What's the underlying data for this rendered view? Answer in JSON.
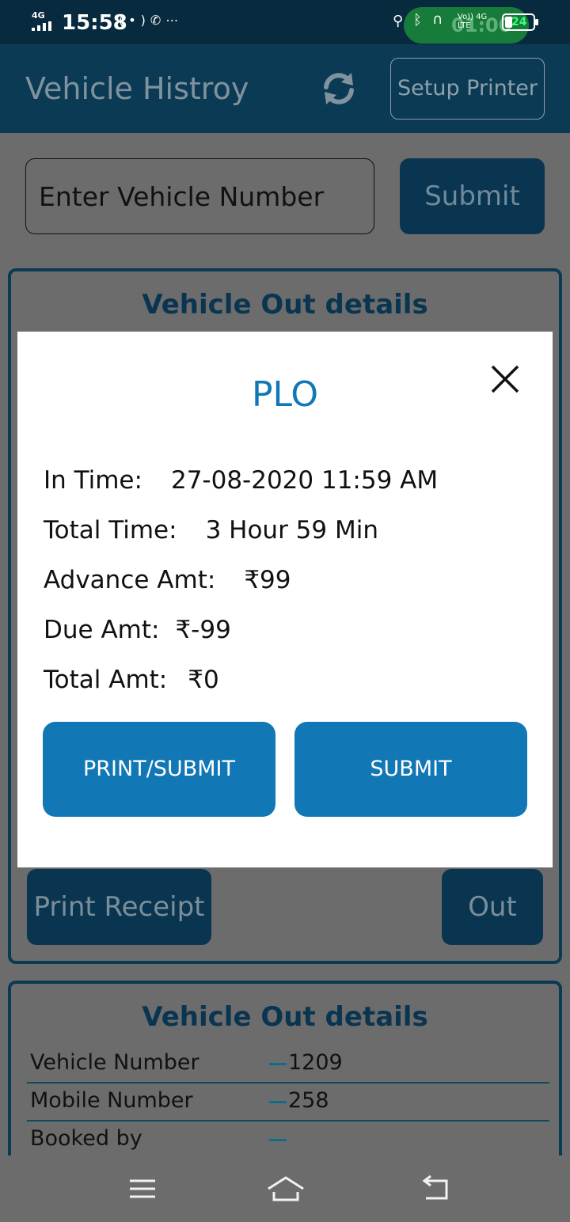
{
  "status_bar": {
    "network": "4G",
    "time": "15:58",
    "call_timer": "01:00",
    "volte_top": "Vo)) 4G",
    "volte_bottom": "LTE",
    "battery": "24"
  },
  "header": {
    "title": "Vehicle Histroy",
    "refresh_icon": "refresh-icon",
    "setup_printer_label": "Setup Printer"
  },
  "search": {
    "placeholder": "Enter Vehicle Number",
    "submit_label": "Submit"
  },
  "out_card": {
    "title": "Vehicle Out details",
    "print_receipt_label": "Print Receipt",
    "out_label": "Out"
  },
  "details_card": {
    "title": "Vehicle Out details",
    "rows": [
      {
        "label": "Vehicle Number",
        "value": "1209"
      },
      {
        "label": "Mobile Number",
        "value": "258"
      },
      {
        "label": "Booked by",
        "value": ""
      }
    ]
  },
  "modal": {
    "title": "PLO",
    "rows": [
      {
        "label": "In Time:",
        "value": "27-08-2020 11:59 AM"
      },
      {
        "label": "Total Time:",
        "value": "3 Hour 59 Min"
      },
      {
        "label": "Advance Amt:",
        "value": "₹99"
      },
      {
        "label": "Due Amt:",
        "value": "₹-99"
      },
      {
        "label": "Total Amt:",
        "value": "₹0"
      }
    ],
    "print_submit_label": "PRINT/SUBMIT",
    "submit_label": "SUBMIT"
  },
  "colors": {
    "appbar": "#0b3a54",
    "accent": "#1177b5",
    "dim_overlay": "#6c6c6c"
  }
}
